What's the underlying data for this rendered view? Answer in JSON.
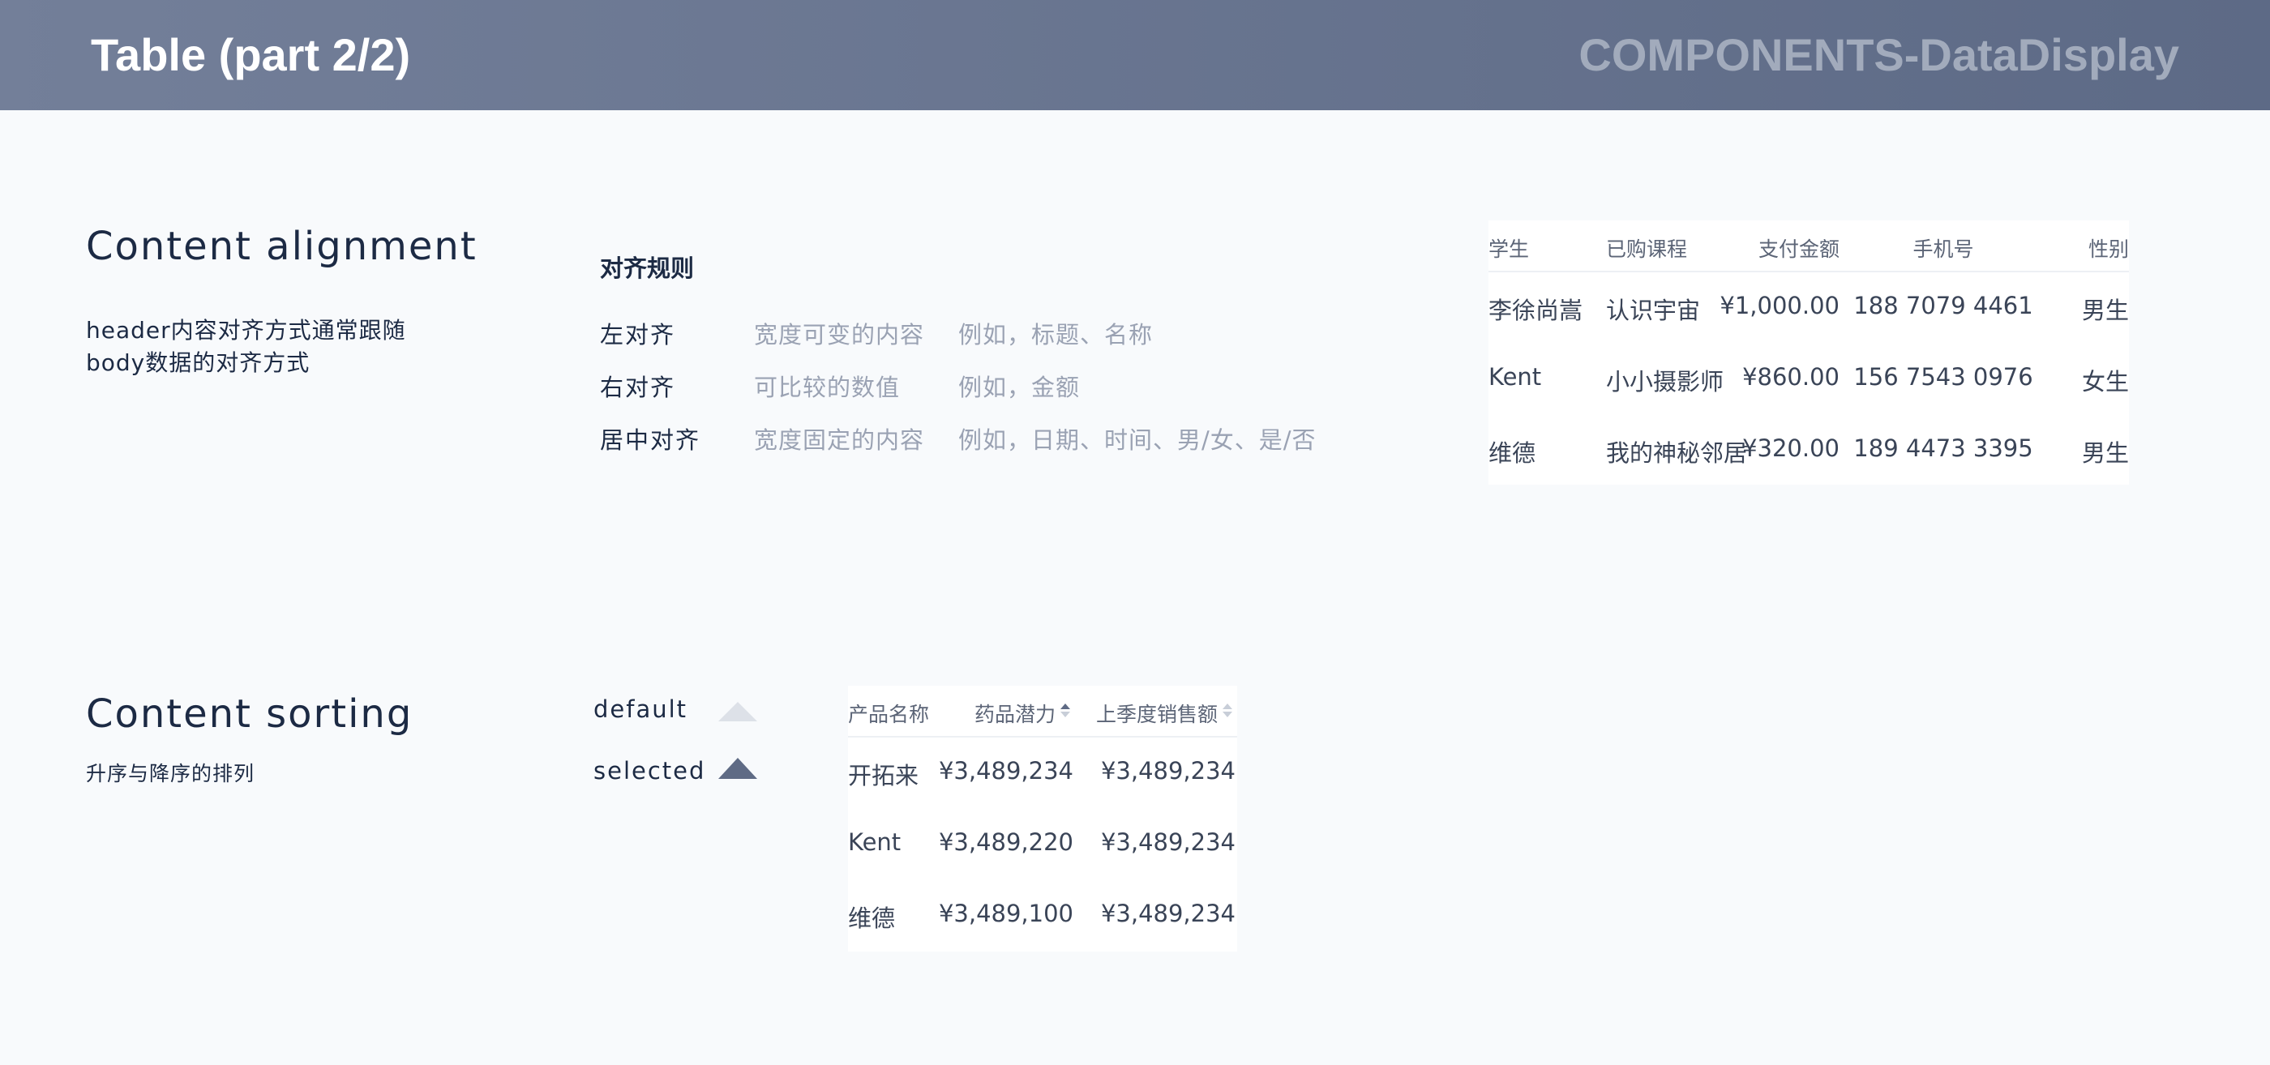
{
  "header": {
    "title": "Table (part 2/2)",
    "section": "COMPONENTS-DataDisplay"
  },
  "alignment": {
    "title": "Content alignment",
    "desc_line1": "header内容对齐方式通常跟随",
    "desc_line2": "body数据的对齐方式",
    "rules_title": "对齐规则",
    "rules": [
      {
        "label": "左对齐",
        "desc": "宽度可变的内容",
        "example": "例如，标题、名称"
      },
      {
        "label": "右对齐",
        "desc": "可比较的数值",
        "example": "例如，金额"
      },
      {
        "label": "居中对齐",
        "desc": "宽度固定的内容",
        "example": "例如，日期、时间、男/女、是/否"
      }
    ],
    "table": {
      "headers": [
        "学生",
        "已购课程",
        "支付金额",
        "手机号",
        "性别"
      ],
      "rows": [
        [
          "李徐尚嵩",
          "认识宇宙",
          "¥1,000.00",
          "188 7079 4461",
          "男生"
        ],
        [
          "Kent",
          "小小摄影师",
          "¥860.00",
          "156 7543 0976",
          "女生"
        ],
        [
          "维德",
          "我的神秘邻居",
          "¥320.00",
          "189 4473 3395",
          "男生"
        ]
      ]
    }
  },
  "sorting": {
    "title": "Content sorting",
    "desc": "升序与降序的排列",
    "default_label": "default",
    "selected_label": "selected",
    "table": {
      "headers": [
        "产品名称",
        "药品潜力",
        "上季度销售额"
      ],
      "rows": [
        [
          "开拓来",
          "¥3,489,234",
          "¥3,489,234"
        ],
        [
          "Kent",
          "¥3,489,220",
          "¥3,489,234"
        ],
        [
          "维德",
          "¥3,489,100",
          "¥3,489,234"
        ]
      ]
    }
  },
  "colors": {
    "header_bg": "#6b7791",
    "title_text": "#1c2a44",
    "muted_text": "#9aa2b3",
    "sort_selected": "#5f6b85",
    "sort_default": "#dde1e8"
  }
}
